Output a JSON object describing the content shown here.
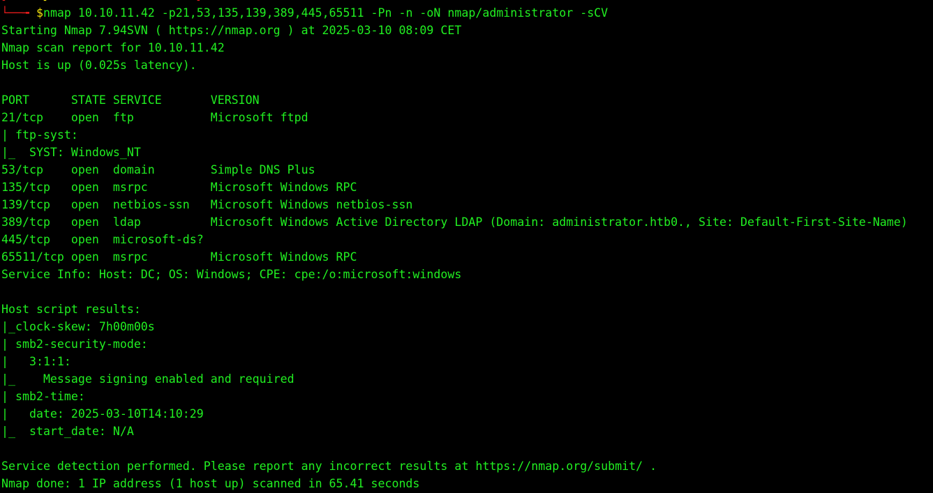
{
  "theme": {
    "background": "#000000",
    "foreground": "#21ef21",
    "prompt_red": "#e01b1b",
    "prompt_yellow": "#f2e30c"
  },
  "prompt": {
    "top_fragment_left": "[",
    "top_fragment_mid": "]",
    "top_fragment_right": "]",
    "elbow": "└──╼ ",
    "dollar": "$",
    "command": "nmap 10.10.11.42 -p21,53,135,139,389,445,65511 -Pn -n -oN nmap/administrator -sCV"
  },
  "output": [
    "Starting Nmap 7.94SVN ( https://nmap.org ) at 2025-03-10 08:09 CET",
    "Nmap scan report for 10.10.11.42",
    "Host is up (0.025s latency).",
    "",
    "PORT      STATE SERVICE       VERSION",
    "21/tcp    open  ftp           Microsoft ftpd",
    "| ftp-syst:",
    "|_  SYST: Windows_NT",
    "53/tcp    open  domain        Simple DNS Plus",
    "135/tcp   open  msrpc         Microsoft Windows RPC",
    "139/tcp   open  netbios-ssn   Microsoft Windows netbios-ssn",
    "389/tcp   open  ldap          Microsoft Windows Active Directory LDAP (Domain: administrator.htb0., Site: Default-First-Site-Name)",
    "445/tcp   open  microsoft-ds?",
    "65511/tcp open  msrpc         Microsoft Windows RPC",
    "Service Info: Host: DC; OS: Windows; CPE: cpe:/o:microsoft:windows",
    "",
    "Host script results:",
    "|_clock-skew: 7h00m00s",
    "| smb2-security-mode:",
    "|   3:1:1:",
    "|_    Message signing enabled and required",
    "| smb2-time:",
    "|   date: 2025-03-10T14:10:29",
    "|_  start_date: N/A",
    "",
    "Service detection performed. Please report any incorrect results at https://nmap.org/submit/ .",
    "Nmap done: 1 IP address (1 host up) scanned in 65.41 seconds"
  ]
}
